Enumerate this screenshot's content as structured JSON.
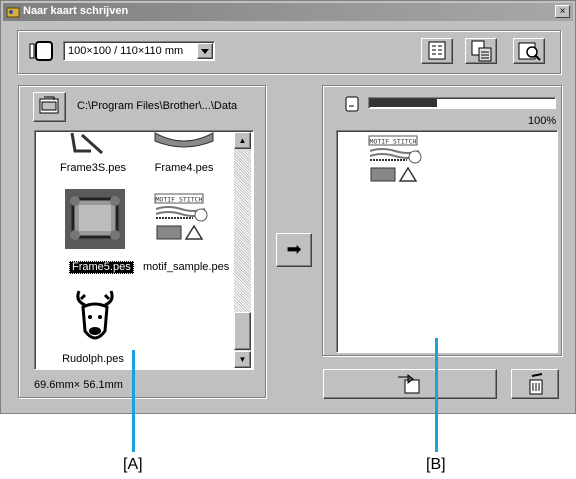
{
  "window": {
    "title": "Naar kaart schrijven",
    "close_label": "×"
  },
  "toolbar": {
    "hoop_size": "100×100 / 110×110 mm",
    "buttons": [
      "grid-view-icon",
      "card-list-icon",
      "card-zoom-icon"
    ]
  },
  "left_panel": {
    "path": "C:\\Program Files\\Brother\\...\\Data",
    "files": [
      {
        "name": "Frame3S.pes",
        "selected": false
      },
      {
        "name": "Frame4.pes",
        "selected": false
      },
      {
        "name": "Frame5.pes",
        "selected": true
      },
      {
        "name": "motif_sample.pes",
        "selected": false
      },
      {
        "name": "Rudolph.pes",
        "selected": false
      }
    ],
    "size_readout": "69.6mm× 56.1mm",
    "scroll": {
      "up_icon": "▲",
      "down_icon": "▼"
    }
  },
  "transfer_button_icon": "➡",
  "right_panel": {
    "progress": 0.36,
    "progress_label": "100%",
    "preview_title": "MOTIF STITCH"
  },
  "callouts": {
    "a": "[A]",
    "b": "[B]"
  }
}
